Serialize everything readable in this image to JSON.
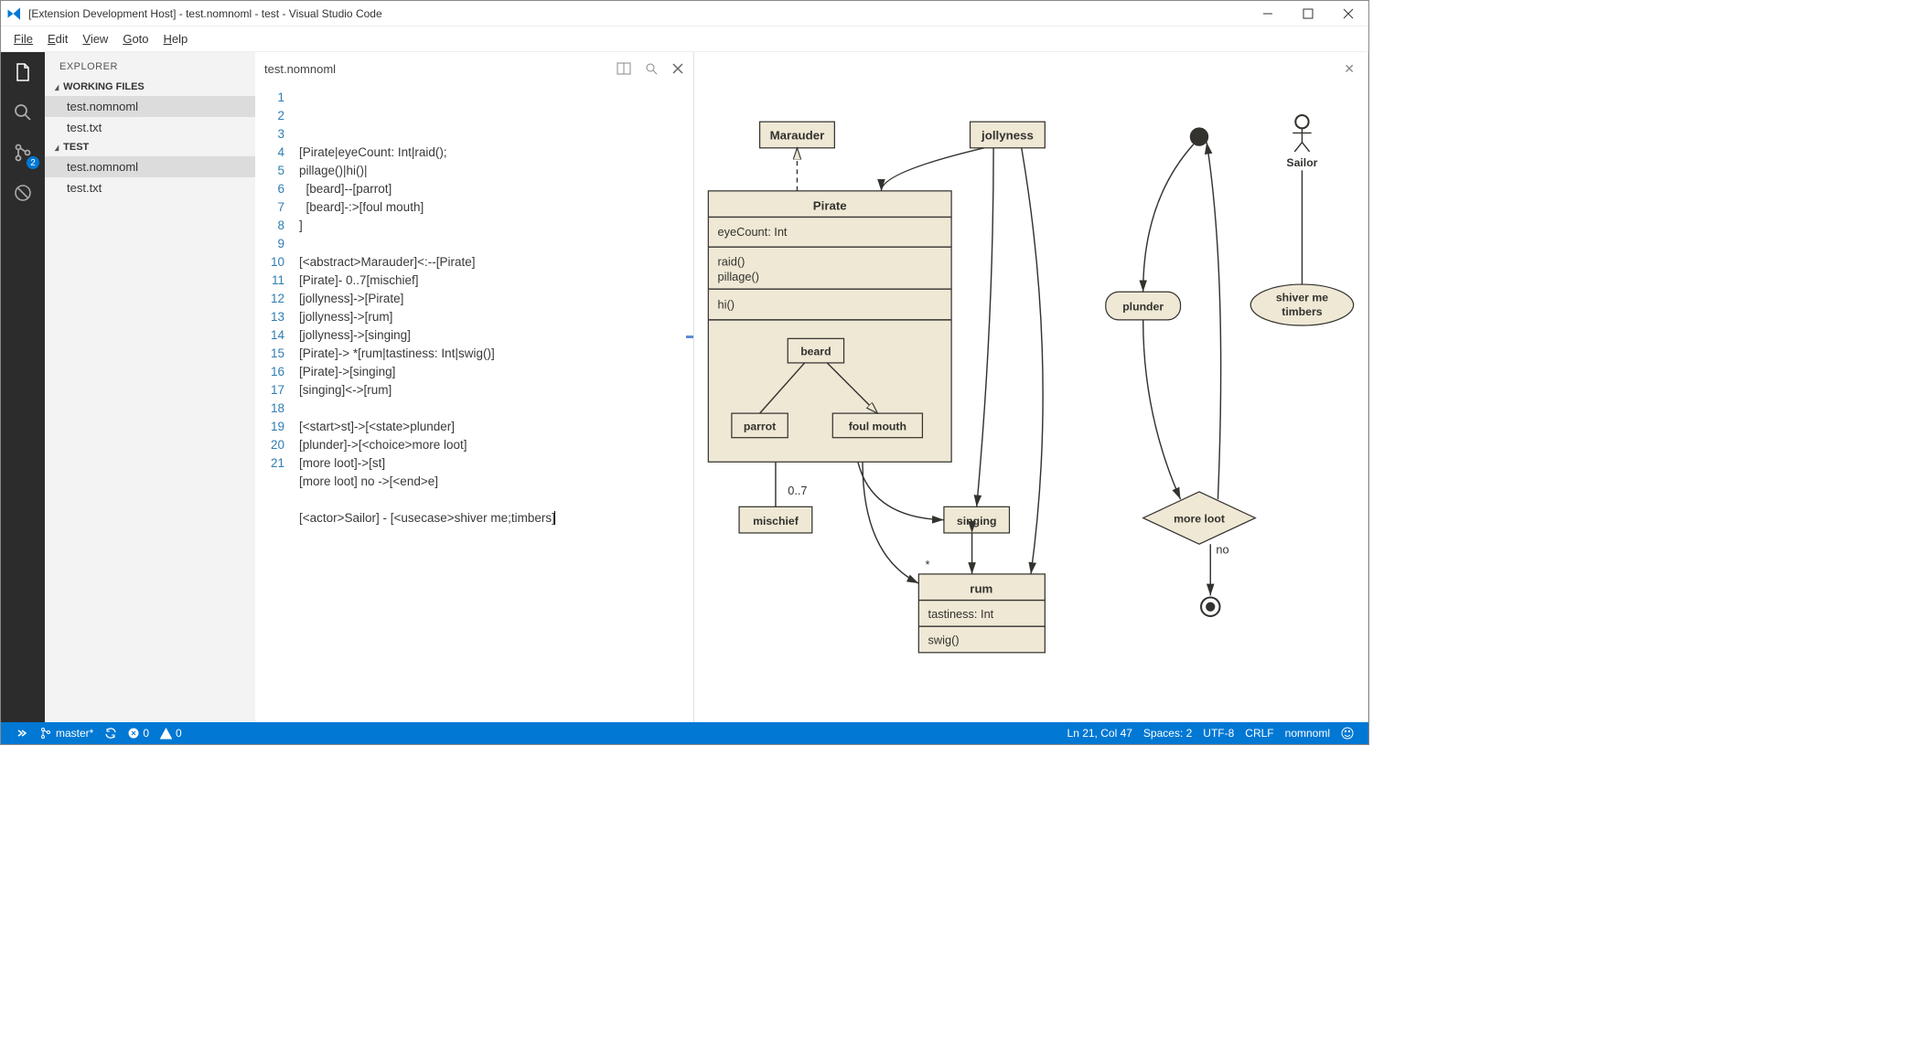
{
  "window": {
    "title": "[Extension Development Host] - test.nomnoml - test - Visual Studio Code"
  },
  "menu": {
    "file": "File",
    "edit": "Edit",
    "view": "View",
    "goto": "Goto",
    "help": "Help"
  },
  "activity": {
    "git_badge": "2"
  },
  "sidebar": {
    "title": "EXPLORER",
    "sections": [
      {
        "label": "WORKING FILES",
        "items": [
          {
            "name": "test.nomnoml",
            "sel": true
          },
          {
            "name": "test.txt"
          }
        ]
      },
      {
        "label": "TEST",
        "items": [
          {
            "name": "test.nomnoml",
            "sel": true
          },
          {
            "name": "test.txt"
          }
        ]
      }
    ]
  },
  "editor": {
    "tab": "test.nomnoml",
    "lines": [
      "[Pirate|eyeCount: Int|raid();",
      "pillage()|hi()|",
      "  [beard]--[parrot]",
      "  [beard]-:>[foul mouth]",
      "]",
      "",
      "[<abstract>Marauder]<:--[Pirate]",
      "[Pirate]- 0..7[mischief]",
      "[jollyness]->[Pirate]",
      "[jollyness]->[rum]",
      "[jollyness]->[singing]",
      "[Pirate]-> *[rum|tastiness: Int|swig()]",
      "[Pirate]->[singing]",
      "[singing]<->[rum]",
      "",
      "[<start>st]->[<state>plunder]",
      "[plunder]->[<choice>more loot]",
      "[more loot]->[st]",
      "[more loot] no ->[<end>e]",
      "",
      "[<actor>Sailor] - [<usecase>shiver me;timbers]"
    ]
  },
  "diagram": {
    "marauder": "Marauder",
    "jollyness": "jollyness",
    "pirate": "Pirate",
    "eyeCount": "eyeCount: Int",
    "raid": "raid()",
    "pillage": "pillage()",
    "hi": "hi()",
    "beard": "beard",
    "parrot": "parrot",
    "foul": "foul mouth",
    "mischief": "mischief",
    "multiplicity": "0..7",
    "singing": "singing",
    "rum": "rum",
    "tastiness": "tastiness: Int",
    "swig": "swig()",
    "star": "*",
    "plunder": "plunder",
    "moreloot": "more loot",
    "no": "no",
    "sailor": "Sailor",
    "shiver1": "shiver me",
    "shiver2": "timbers"
  },
  "status": {
    "branch": "master*",
    "errors": "0",
    "warnings": "0",
    "position": "Ln 21, Col 47",
    "spaces": "Spaces: 2",
    "encoding": "UTF-8",
    "eol": "CRLF",
    "lang": "nomnoml"
  }
}
